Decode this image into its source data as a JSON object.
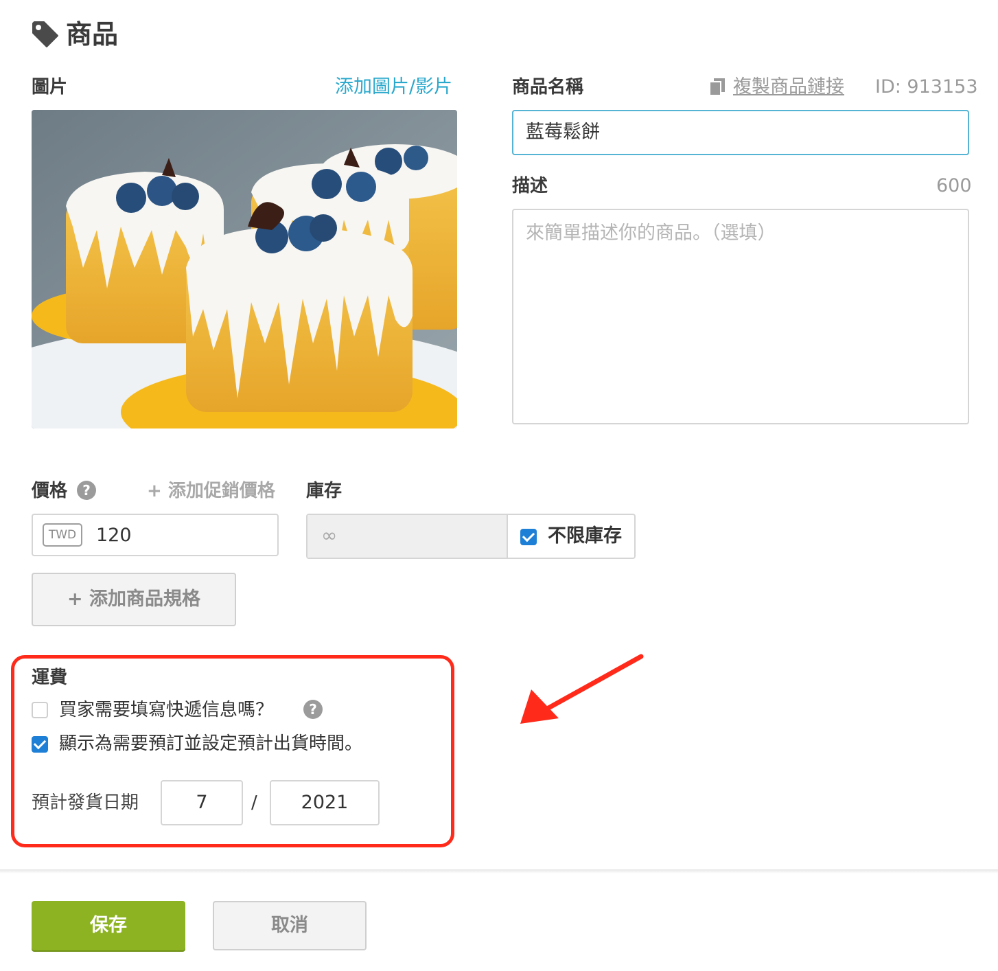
{
  "header": {
    "title": "商品",
    "icon": "tag-icon"
  },
  "image_section": {
    "label": "圖片",
    "add_link": "添加圖片/影片",
    "photo_alt": "blueberry-cake-photo"
  },
  "product": {
    "name_label": "商品名稱",
    "copy_link": "複製商品鏈接",
    "id_text": "ID: 913153",
    "name_value": "藍莓鬆餅",
    "desc_label": "描述",
    "desc_counter": "600",
    "desc_placeholder": "來簡單描述你的商品。（選填）"
  },
  "price": {
    "label": "價格",
    "promo_link": "+ 添加促銷價格",
    "currency": "TWD",
    "value": "120"
  },
  "stock": {
    "label": "庫存",
    "value": "∞",
    "unlimited_label": "不限庫存",
    "unlimited_checked": true
  },
  "add_spec_button": "+ 添加商品規格",
  "shipping": {
    "title": "運費",
    "need_courier_info": {
      "label": "買家需要填寫快遞信息嗎？",
      "checked": false
    },
    "preorder": {
      "label": "顯示為需要預訂並設定預計出貨時間。",
      "checked": true
    },
    "ship_date_label": "預計發貨日期",
    "month": "7",
    "separator": "/",
    "year": "2021"
  },
  "footer": {
    "save": "保存",
    "cancel": "取消"
  },
  "colors": {
    "accent": "#2aa8cc",
    "save": "#8db323",
    "highlight": "#ff2a1a",
    "checkbox": "#1e7fd6"
  }
}
